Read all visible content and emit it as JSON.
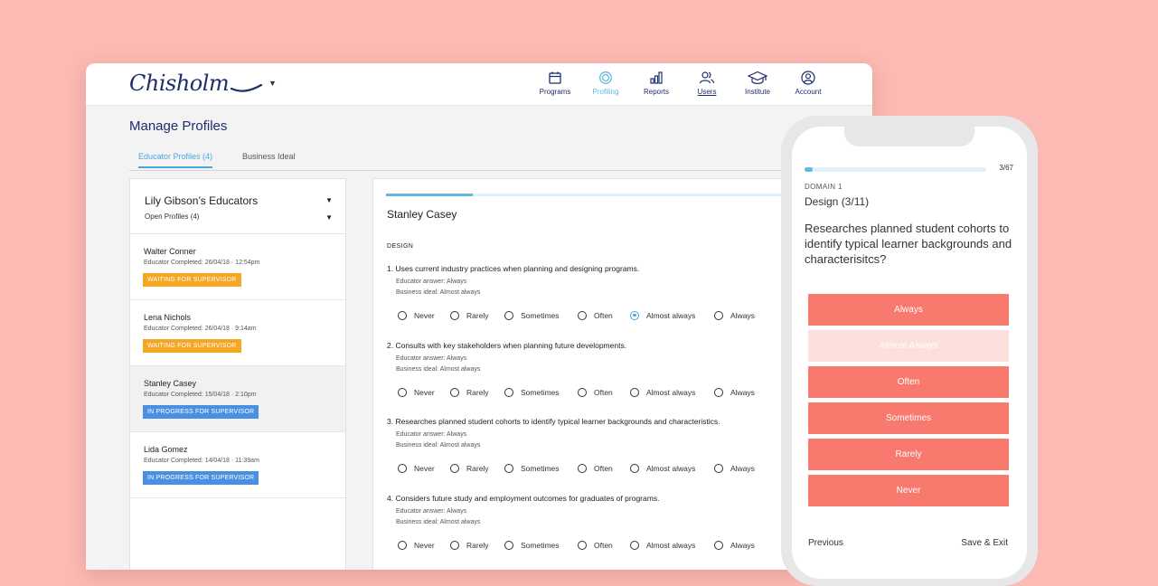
{
  "app": {
    "logo_text": "Chisholm"
  },
  "nav": {
    "items": [
      {
        "label": "Programs",
        "icon": "calendar-icon"
      },
      {
        "label": "Profiling",
        "icon": "target-icon",
        "active": true
      },
      {
        "label": "Reports",
        "icon": "bar-chart-icon"
      },
      {
        "label": "Users",
        "icon": "users-icon"
      },
      {
        "label": "Institute",
        "icon": "graduation-cap-icon"
      },
      {
        "label": "Account",
        "icon": "account-icon"
      }
    ]
  },
  "page": {
    "title": "Manage Profiles",
    "tabs": [
      {
        "label": "Educator Profiles (4)",
        "active": true
      },
      {
        "label": "Business Ideal",
        "active": false
      }
    ]
  },
  "educators_panel": {
    "title": "Lily Gibson’s Educators",
    "filter": "Open Profiles (4)",
    "educators": [
      {
        "name": "Walter Conner",
        "completed": "Educator Completed: 26/04/18 · 12:54pm",
        "status": "WAITING FOR SUPERVISOR",
        "status_color": "#f5a623"
      },
      {
        "name": "Lena Nichols",
        "completed": "Educator Completed: 26/04/18 · 9:14am",
        "status": "WAITING FOR SUPERVISOR",
        "status_color": "#f5a623"
      },
      {
        "name": "Stanley Casey",
        "completed": "Educator Completed: 15/04/18 · 2:10pm",
        "status": "IN PROGRESS FOR SUPERVISOR",
        "status_color": "#4a90e2",
        "selected": true
      },
      {
        "name": "Lida Gomez",
        "completed": "Educator Completed: 14/04/18 · 11:39am",
        "status": "IN PROGRESS FOR SUPERVISOR",
        "status_color": "#4a90e2"
      }
    ]
  },
  "profile": {
    "name": "Stanley Casey",
    "section": "DESIGN",
    "options": [
      "Never",
      "Rarely",
      "Sometimes",
      "Often",
      "Almost always",
      "Always"
    ],
    "questions": [
      {
        "text": "1. Uses current industry practices when planning and designing programs.",
        "educator_answer": "Educator answer: Always",
        "business_ideal": "Business ideal: Almost always",
        "selected": "Almost always"
      },
      {
        "text": "2. Consults with key stakeholders when planning future developments.",
        "educator_answer": "Educator answer: Always",
        "business_ideal": "Business ideal: Almost always",
        "selected": null
      },
      {
        "text": "3. Researches planned student cohorts to identify typical learner backgrounds and characteristics.",
        "educator_answer": "Educator answer: Always",
        "business_ideal": "Business ideal: Almost always",
        "selected": null
      },
      {
        "text": "4. Considers future study and employment outcomes for graduates of programs.",
        "educator_answer": "Educator answer: Always",
        "business_ideal": "Business ideal: Almost always",
        "selected": null
      }
    ]
  },
  "mobile": {
    "counter": "3/67",
    "progress_fraction": 0.045,
    "domain": "DOMAIN 1",
    "design": "Design (3/11)",
    "question": "Researches planned student cohorts to identify typical learner backgrounds and characterisitcs?",
    "answers": [
      {
        "label": "Always",
        "faded": false
      },
      {
        "label": "Almost Always",
        "faded": true
      },
      {
        "label": "Often",
        "faded": false
      },
      {
        "label": "Sometimes",
        "faded": false
      },
      {
        "label": "Rarely",
        "faded": false
      },
      {
        "label": "Never",
        "faded": false
      }
    ],
    "previous": "Previous",
    "save_exit": "Save & Exit"
  },
  "colors": {
    "background": "#fbbab3",
    "brand_navy": "#1e2d6b",
    "accent_blue": "#4aa7dd",
    "answer_coral": "#f8796d",
    "waiting": "#f5a623",
    "in_progress": "#4a90e2"
  }
}
